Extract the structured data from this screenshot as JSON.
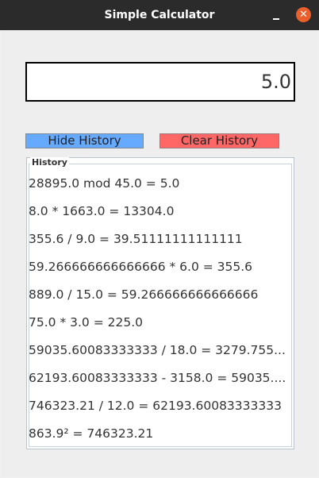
{
  "window": {
    "title": "Simple Calculator",
    "minimize_icon": "minimize-icon",
    "close_icon": "close-icon",
    "close_glyph": "✕"
  },
  "display": {
    "value": "5.0"
  },
  "buttons": {
    "hide_history": "Hide History",
    "clear_history": "Clear History"
  },
  "history": {
    "legend": "History",
    "items": [
      "28895.0 mod 45.0 = 5.0",
      "8.0 * 1663.0 = 13304.0",
      "355.6 / 9.0 = 39.51111111111111",
      "59.266666666666666 * 6.0 = 355.6",
      "889.0 / 15.0 = 59.266666666666666",
      "75.0 * 3.0 = 225.0",
      "59035.60083333333 / 18.0 = 3279.755...",
      "62193.60083333333 - 3158.0 = 59035....",
      "746323.21 / 12.0 = 62193.60083333333",
      "863.9² = 746323.21"
    ]
  },
  "colors": {
    "titlebar": "#2b2b2b",
    "close_button": "#e9602d",
    "hide_button": "#66aaff",
    "clear_button": "#ff6666"
  }
}
